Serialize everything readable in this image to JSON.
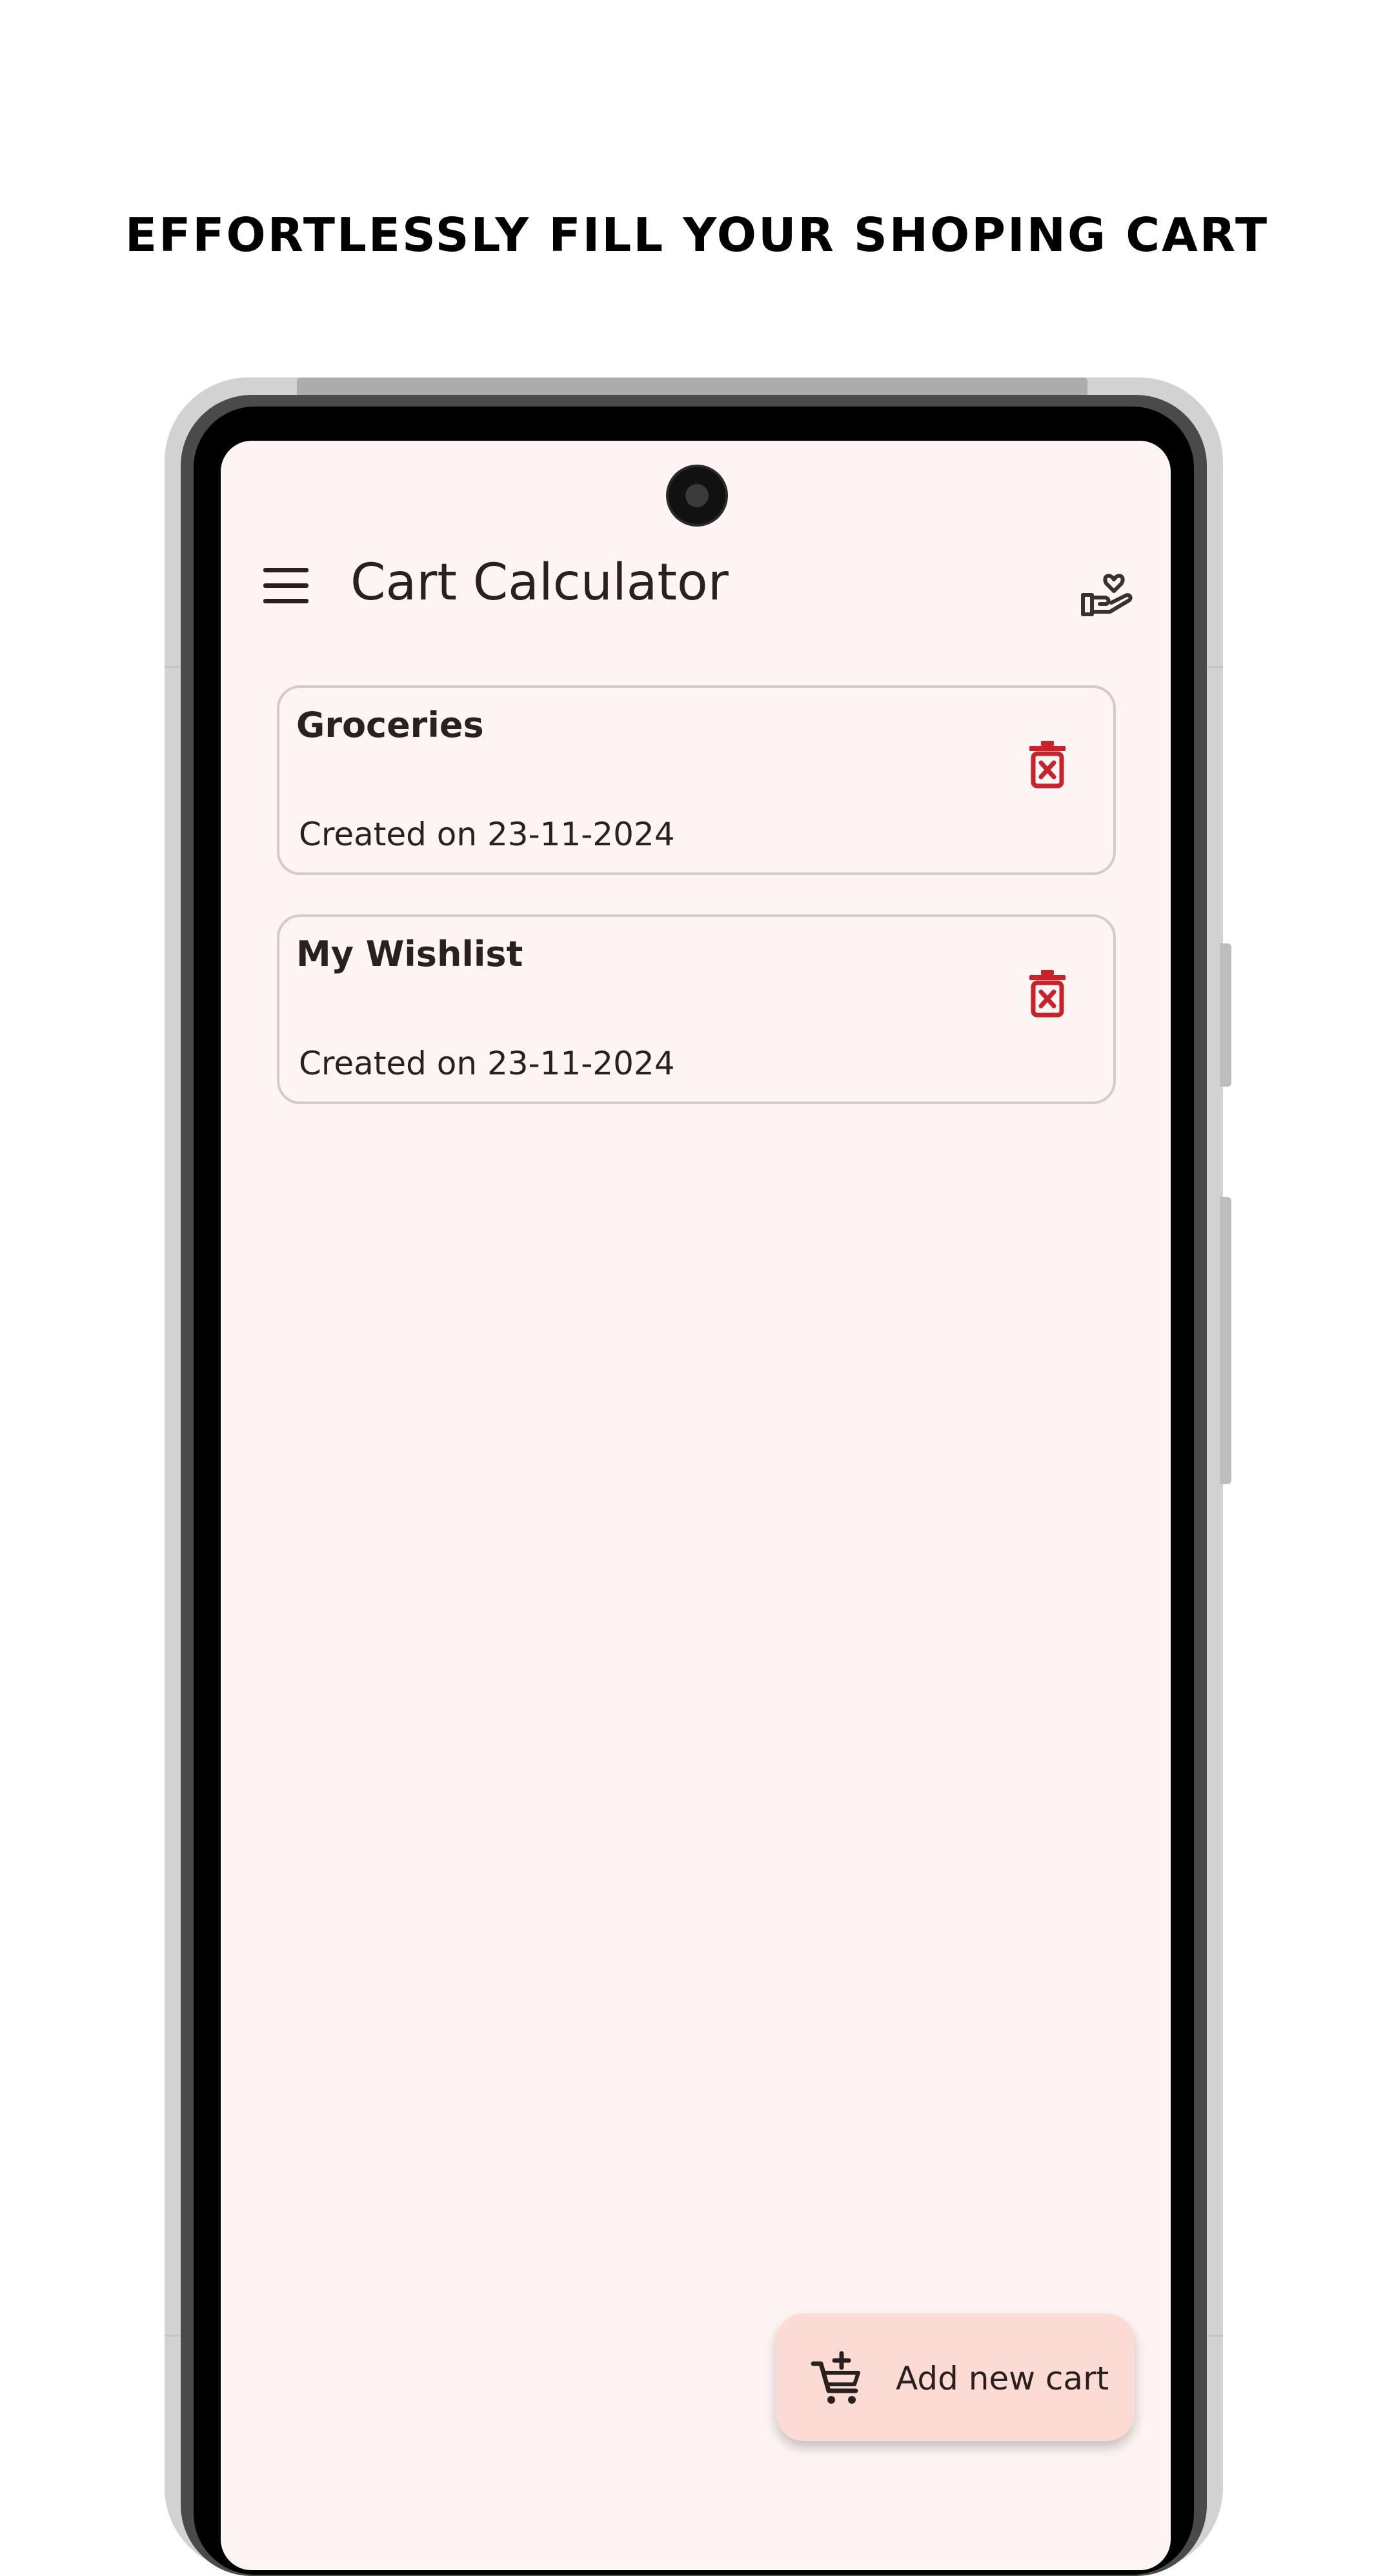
{
  "headline": "EFFORTLESSLY FILL YOUR SHOPING CART",
  "app_bar": {
    "title": "Cart Calculator",
    "menu_icon": "menu-icon",
    "action_icon": "hand-heart-icon"
  },
  "carts": [
    {
      "name": "Groceries",
      "created": "Created on 23-11-2024"
    },
    {
      "name": "My Wishlist",
      "created": "Created on 23-11-2024"
    }
  ],
  "fab": {
    "label": "Add new cart",
    "icon": "cart-add-icon"
  },
  "colors": {
    "background": "#fdf5f4",
    "text": "#2a2020",
    "delete": "#c8232d",
    "card_border": "#d9c8c8",
    "fab": "#fddbd5"
  }
}
